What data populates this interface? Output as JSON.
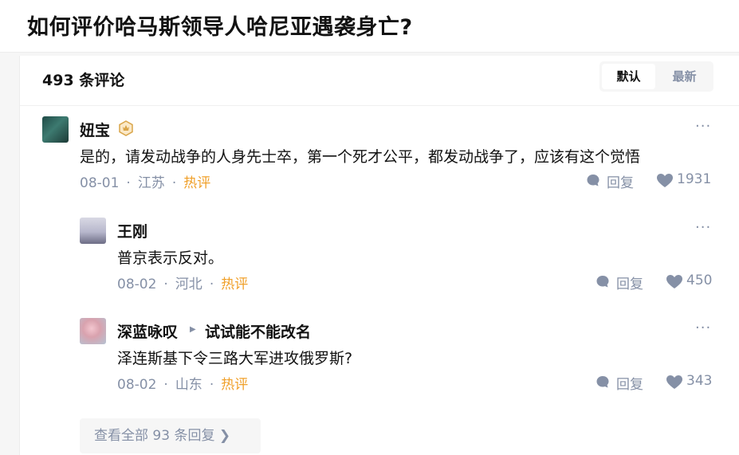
{
  "question": {
    "title": "如何评价哈马斯领导人哈尼亚遇袭身亡?"
  },
  "header": {
    "comment_count": "493 条评论",
    "sort_default": "默认",
    "sort_latest": "最新"
  },
  "comments": [
    {
      "author": "妞宝",
      "content": "是的，请发动战争的人身先士卒，第一个死才公平，都发动战争了，应该有这个觉悟",
      "date": "08-01",
      "location": "江苏",
      "tag": "热评",
      "reply_label": "回复",
      "likes": "1931",
      "badge_icon": "level-badge-icon"
    },
    {
      "author": "王刚",
      "content": "普京表示反对。",
      "date": "08-02",
      "location": "河北",
      "tag": "热评",
      "reply_label": "回复",
      "likes": "450"
    },
    {
      "author": "深蓝咏叹",
      "reply_to": "试试能不能改名",
      "content": "泽连斯基下令三路大军进攻俄罗斯?",
      "date": "08-02",
      "location": "山东",
      "tag": "热评",
      "reply_label": "回复",
      "likes": "343"
    }
  ],
  "more_icon": "···",
  "view_all": "查看全部 93 条回复 ❯",
  "colors": {
    "muted": "#8590a6",
    "hot": "#f0a02a",
    "text": "#121212"
  }
}
